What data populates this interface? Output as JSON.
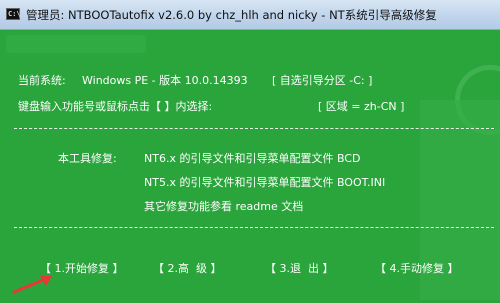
{
  "window": {
    "title": "管理员:  NTBOOTautofix v2.6.0 by chz_hlh and nicky - NT系统引导高级修复",
    "icon": "cmd-icon"
  },
  "status": {
    "system_label": "当前系统:",
    "system_value": "Windows PE - 版本 10.0.14393",
    "partition": "[ 自选引导分区 -C: ]",
    "prompt": "键盘输入功能号或鼠标点击【 】内选择:",
    "region": "[ 区域 = zh-CN ]"
  },
  "info": {
    "label": "本工具修复:",
    "line1": "NT6.x 的引导文件和引导菜单配置文件 BCD",
    "line2": "NT5.x 的引导文件和引导菜单配置文件 BOOT.INI",
    "line3": "其它修复功能参看 readme 文档"
  },
  "menu": {
    "start": "【 1.开始修复 】",
    "advanced": "【 2.高  级 】",
    "exit": "【 3.退  出 】",
    "manual": "【 4.手动修复 】"
  },
  "colors": {
    "console_bg": "#2aa53c",
    "text": "#ffffff",
    "arrow": "#e53935"
  }
}
